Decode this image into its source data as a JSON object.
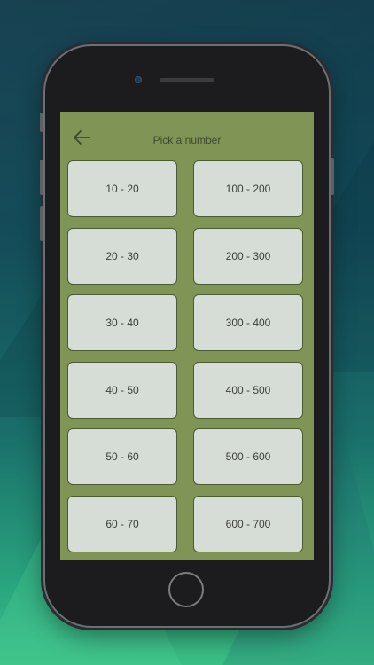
{
  "header": {
    "title": "Pick a number",
    "back_icon": "arrow-left-icon"
  },
  "ranges": [
    [
      "10 - 20",
      "100 - 200"
    ],
    [
      "20 - 30",
      "200 - 300"
    ],
    [
      "30 - 40",
      "300 - 400"
    ],
    [
      "40 - 50",
      "400 - 500"
    ],
    [
      "50 - 60",
      "500 - 600"
    ],
    [
      "60 - 70",
      "600 - 700"
    ]
  ],
  "colors": {
    "screen_background": "#809456",
    "tile_background": "#d6ddd6",
    "tile_border": "#4b5a37",
    "text": "#3c3f3c"
  }
}
